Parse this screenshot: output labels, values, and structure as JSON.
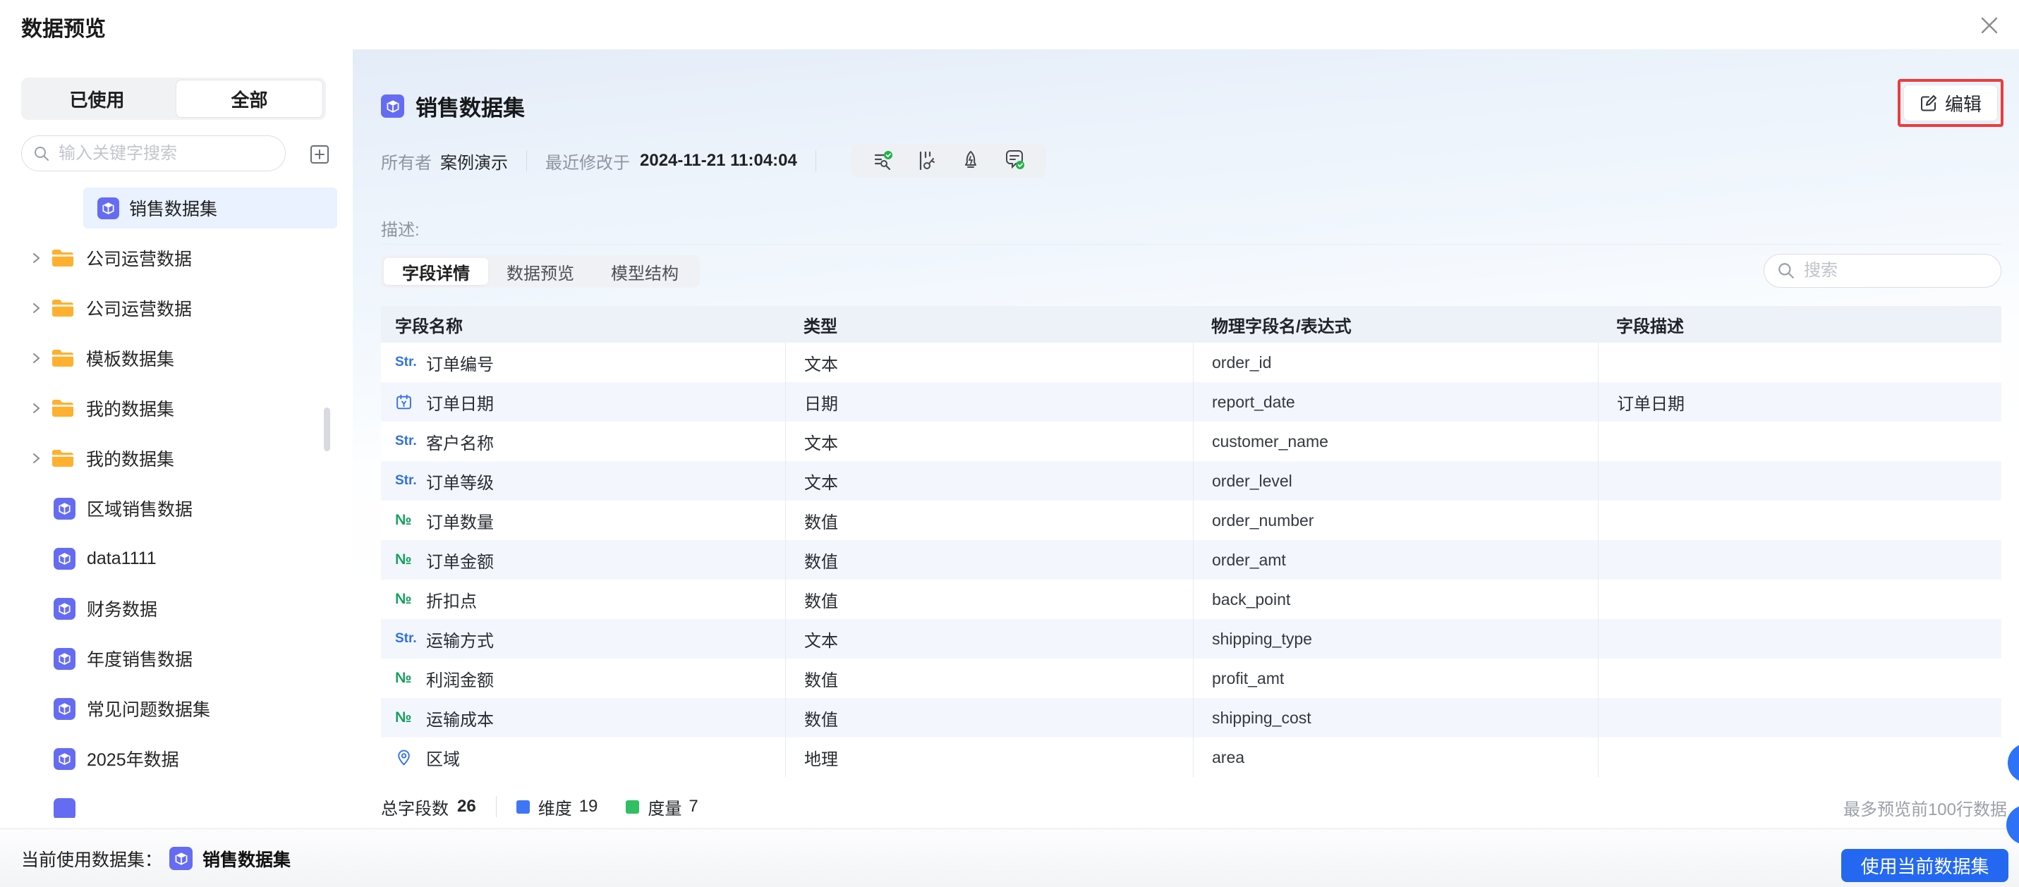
{
  "header": {
    "title": "数据预览"
  },
  "sidebar": {
    "tabs": {
      "used": "已使用",
      "all": "全部",
      "active": "全部"
    },
    "search_placeholder": "输入关键字搜索",
    "selected_item": {
      "label": "销售数据集"
    },
    "folders": [
      {
        "label": "公司运营数据"
      },
      {
        "label": "公司运营数据"
      },
      {
        "label": "模板数据集"
      },
      {
        "label": "我的数据集"
      },
      {
        "label": "我的数据集"
      }
    ],
    "datasets": [
      {
        "label": "区域销售数据"
      },
      {
        "label": "data1111"
      },
      {
        "label": "财务数据"
      },
      {
        "label": "年度销售数据"
      },
      {
        "label": "常见问题数据集"
      },
      {
        "label": "2025年数据"
      }
    ]
  },
  "dataset": {
    "name": "销售数据集",
    "owner_label": "所有者",
    "owner": "案例演示",
    "modified_label": "最近修改于",
    "modified_time": "2024-11-21 11:04:04",
    "desc_label": "描述:",
    "edit_button": "编辑",
    "toolbar_icons": [
      "field-check-icon",
      "lineage-icon",
      "rocket-icon",
      "comment-check-icon"
    ]
  },
  "content": {
    "tabs": [
      {
        "label": "字段详情",
        "active": true
      },
      {
        "label": "数据预览",
        "active": false
      },
      {
        "label": "模型结构",
        "active": false
      }
    ],
    "search_placeholder": "搜索"
  },
  "table": {
    "headers": [
      "字段名称",
      "类型",
      "物理字段名/表达式",
      "字段描述"
    ],
    "rows": [
      {
        "icon": "text",
        "name": "订单编号",
        "type": "文本",
        "physical": "order_id",
        "desc": ""
      },
      {
        "icon": "date",
        "name": "订单日期",
        "type": "日期",
        "physical": "report_date",
        "desc": "订单日期"
      },
      {
        "icon": "text",
        "name": "客户名称",
        "type": "文本",
        "physical": "customer_name",
        "desc": ""
      },
      {
        "icon": "text",
        "name": "订单等级",
        "type": "文本",
        "physical": "order_level",
        "desc": ""
      },
      {
        "icon": "number",
        "name": "订单数量",
        "type": "数值",
        "physical": "order_number",
        "desc": ""
      },
      {
        "icon": "number",
        "name": "订单金额",
        "type": "数值",
        "physical": "order_amt",
        "desc": ""
      },
      {
        "icon": "number",
        "name": "折扣点",
        "type": "数值",
        "physical": "back_point",
        "desc": ""
      },
      {
        "icon": "text",
        "name": "运输方式",
        "type": "文本",
        "physical": "shipping_type",
        "desc": ""
      },
      {
        "icon": "number",
        "name": "利润金额",
        "type": "数值",
        "physical": "profit_amt",
        "desc": ""
      },
      {
        "icon": "number",
        "name": "运输成本",
        "type": "数值",
        "physical": "shipping_cost",
        "desc": ""
      },
      {
        "icon": "geo",
        "name": "区域",
        "type": "地理",
        "physical": "area",
        "desc": ""
      }
    ]
  },
  "badges": {
    "text_badge": "Str.",
    "number_badge": "№"
  },
  "summary": {
    "total_label": "总字段数",
    "total": "26",
    "dimension_label": "维度",
    "dimension": "19",
    "measure_label": "度量",
    "measure": "7",
    "preview_note": "最多预览前100行数据"
  },
  "footer": {
    "current_label": "当前使用数据集：",
    "dataset": "销售数据集",
    "use_button": "使用当前数据集"
  },
  "colors": {
    "accent_blue": "#2468f2",
    "dimension_blue": "#3f76f5",
    "measure_green": "#30bf62",
    "dataset_icon_purple": "#656cf2",
    "folder_amber": "#ffb02e",
    "annotation_red": "#f03b3b",
    "selected_row_blue": "#e9f2fe",
    "table_header_bg": "#edf1f8"
  }
}
